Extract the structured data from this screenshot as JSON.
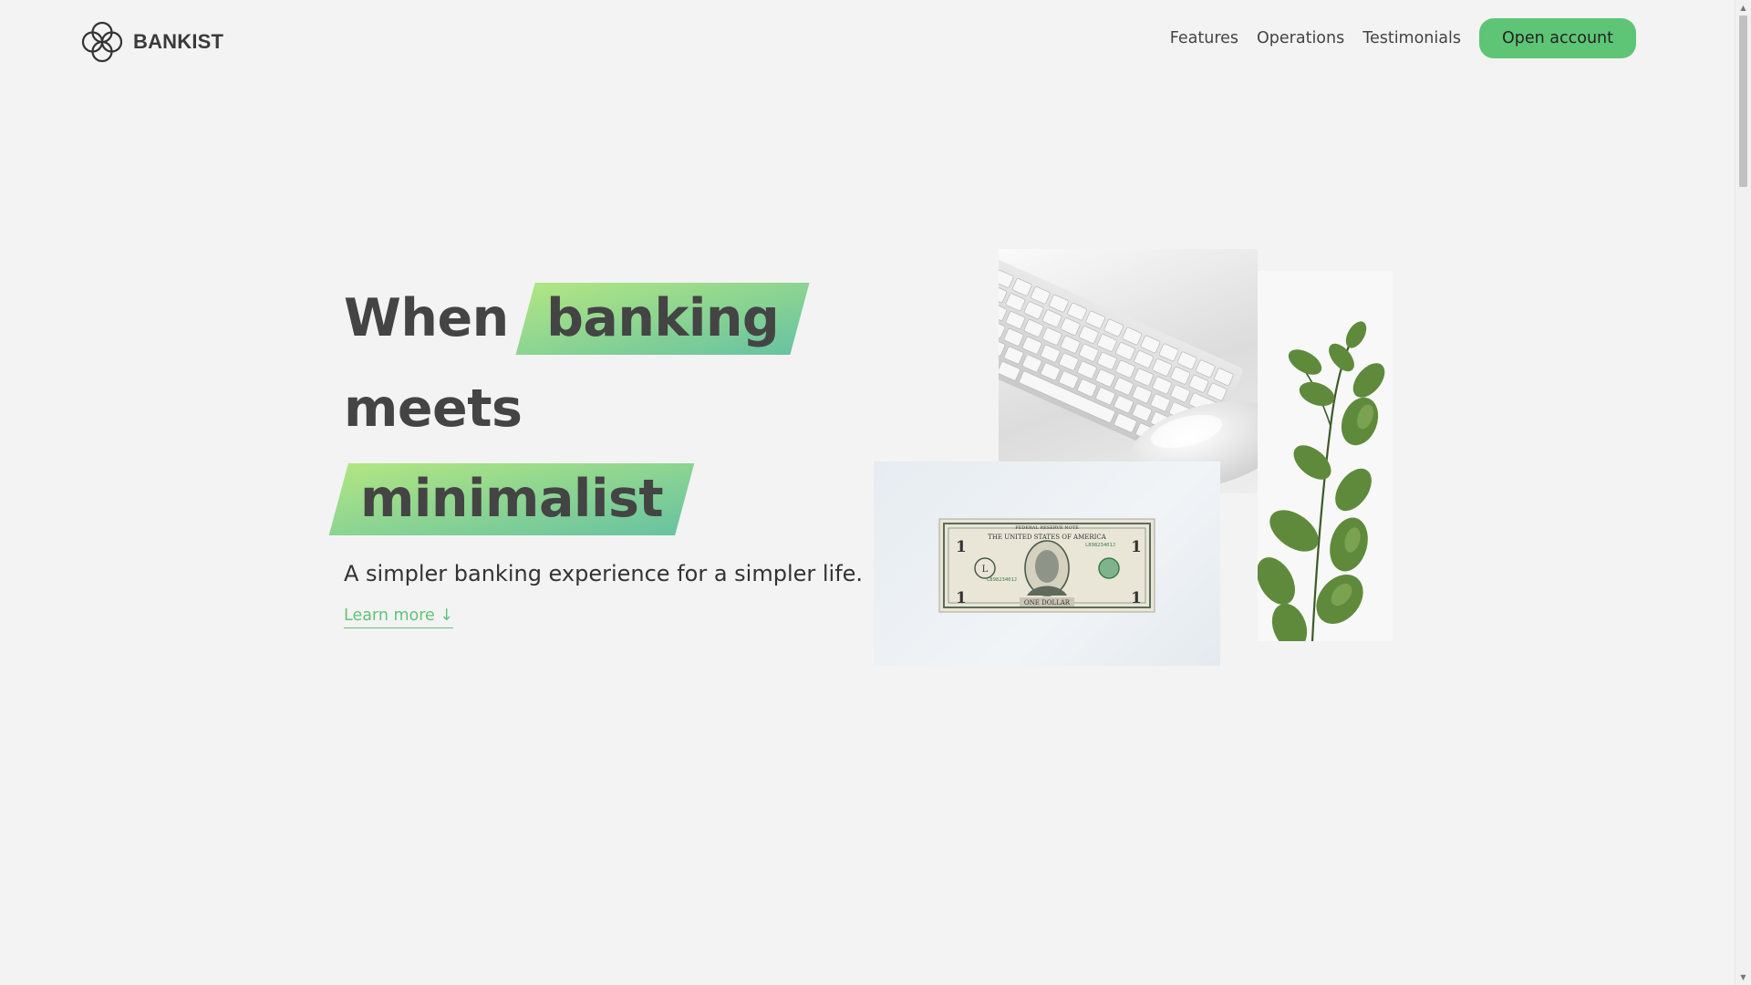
{
  "brand": {
    "name": "BANKIST",
    "accent_color": "#5ec576"
  },
  "nav": {
    "links": [
      "Features",
      "Operations",
      "Testimonials"
    ],
    "cta_label": "Open account"
  },
  "hero": {
    "headline": {
      "word1": "When",
      "word2": "banking",
      "word3": "meets",
      "word4": "minimalist"
    },
    "subtitle": "A simpler banking experience for a simpler life.",
    "learn_more": "Learn more ↓",
    "images": [
      "keyboard-and-mouse",
      "eucalyptus-plant",
      "dollar-bill"
    ],
    "bill": {
      "header": "FEDERAL RESERVE NOTE",
      "country": "THE UNITED STATES OF AMERICA",
      "serial": "L89823401J",
      "denomination": "1",
      "value_text": "ONE DOLLAR"
    }
  },
  "scrollbar": {
    "up_icon": "arrow-up",
    "down_icon": "arrow-down"
  }
}
